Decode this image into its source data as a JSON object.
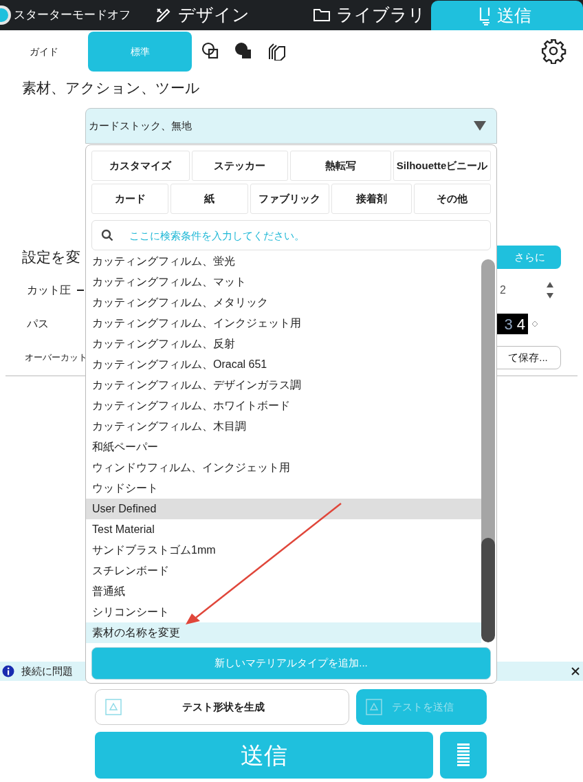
{
  "starter_mode": {
    "label": "スターターモードオフ",
    "on": false
  },
  "top_tabs": [
    {
      "label": "デザイン",
      "selected": false
    },
    {
      "label": "ライブラリ",
      "selected": false
    },
    {
      "label": "送信",
      "selected": true
    }
  ],
  "sub_tabs": [
    {
      "label": "ガイド",
      "selected": false
    },
    {
      "label": "標準",
      "selected": true
    }
  ],
  "section_title": "素材、アクション、ツール",
  "material_select": {
    "value": "カードストック、無地",
    "expanded": true
  },
  "settings": {
    "title": "設定を変",
    "more_button": "さらに",
    "rows": [
      {
        "label": "カット圧",
        "value": "2"
      },
      {
        "label": "パス",
        "digits": [
          "3",
          "4"
        ]
      },
      {
        "label": "オーバーカット",
        "button": "て保存..."
      }
    ]
  },
  "dropdown": {
    "categories": [
      [
        "カスタマイズ",
        "ステッカー",
        "熱転写",
        "Silhouetteビニール"
      ],
      [
        "カード",
        "紙",
        "ファブリック",
        "接着剤",
        "その他"
      ]
    ],
    "search": {
      "placeholder": "ここに検索条件を入力してください。"
    },
    "items": [
      {
        "kind": "item",
        "label": "カッティングフィルム、蛍光",
        "selected": false
      },
      {
        "kind": "item",
        "label": "カッティングフィルム、マット",
        "selected": false
      },
      {
        "kind": "item",
        "label": "カッティングフィルム、メタリック",
        "selected": false
      },
      {
        "kind": "item",
        "label": "カッティングフィルム、インクジェット用",
        "selected": false
      },
      {
        "kind": "item",
        "label": "カッティングフィルム、反射",
        "selected": false
      },
      {
        "kind": "item",
        "label": "カッティングフィルム、Oracal 651",
        "selected": false
      },
      {
        "kind": "item",
        "label": "カッティングフィルム、デザインガラス調",
        "selected": false
      },
      {
        "kind": "item",
        "label": "カッティングフィルム、ホワイトボード",
        "selected": false
      },
      {
        "kind": "item",
        "label": "カッティングフィルム、木目調",
        "selected": false
      },
      {
        "kind": "item",
        "label": "和紙ペーパー",
        "selected": false
      },
      {
        "kind": "item",
        "label": "ウィンドウフィルム、インクジェット用",
        "selected": false
      },
      {
        "kind": "item",
        "label": "ウッドシート",
        "selected": false
      },
      {
        "kind": "header",
        "label": "User Defined",
        "selected": false
      },
      {
        "kind": "item",
        "label": "Test Material",
        "selected": false
      },
      {
        "kind": "item",
        "label": "サンドブラストゴム1mm",
        "selected": false
      },
      {
        "kind": "item",
        "label": "スチレンボード",
        "selected": false
      },
      {
        "kind": "item",
        "label": "普通紙",
        "selected": false
      },
      {
        "kind": "item",
        "label": "シリコンシート",
        "selected": false
      },
      {
        "kind": "item",
        "label": "素材の名称を変更",
        "selected": true
      }
    ],
    "add_button": "新しいマテリアルタイプを追加..."
  },
  "notification": {
    "text": "接続に問題"
  },
  "test_buttons": [
    {
      "label": "テスト形状を生成",
      "disabled": false
    },
    {
      "label": "テストを送信",
      "disabled": true
    }
  ],
  "send_button": "送信"
}
